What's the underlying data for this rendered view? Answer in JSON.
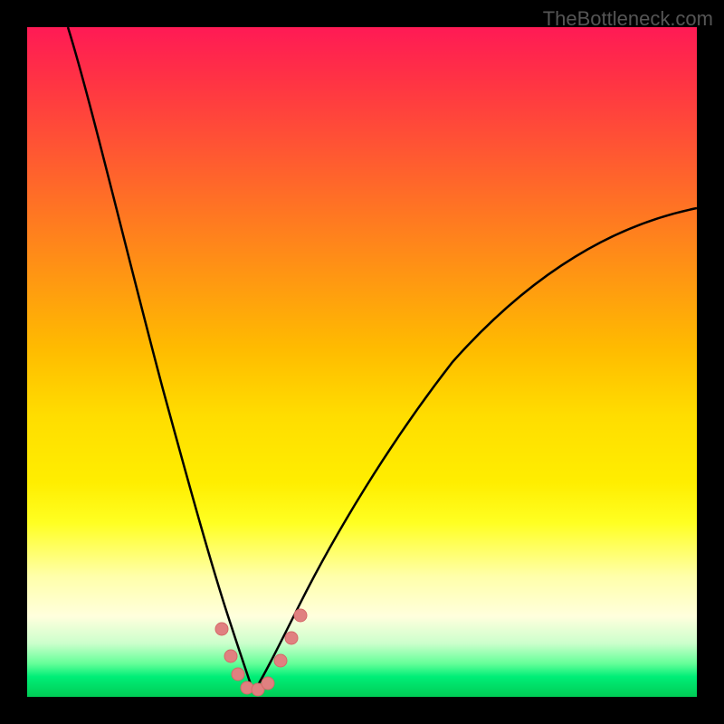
{
  "watermark": "TheBottleneck.com",
  "chart_data": {
    "type": "line",
    "title": "",
    "xlabel": "",
    "ylabel": "",
    "xlim": [
      0,
      100
    ],
    "ylim": [
      0,
      100
    ],
    "description": "Bottleneck V-curve over rainbow gradient background (red=high bottleneck at top, green=optimal at bottom). Two black curves descend from upper edges to meet near x≈33 at the bottom, with salmon dot markers near the minimum.",
    "background_gradient": {
      "stops": [
        {
          "pos": 0,
          "color": "#ff1a55"
        },
        {
          "pos": 0.5,
          "color": "#ffdd00"
        },
        {
          "pos": 0.9,
          "color": "#ffffdd"
        },
        {
          "pos": 1.0,
          "color": "#00cc55"
        }
      ]
    },
    "series": [
      {
        "name": "left-curve",
        "x": [
          5,
          8,
          12,
          16,
          20,
          24,
          27,
          30,
          32,
          33
        ],
        "y": [
          100,
          85,
          68,
          52,
          38,
          25,
          15,
          7,
          2,
          0
        ]
      },
      {
        "name": "right-curve",
        "x": [
          33,
          36,
          40,
          45,
          52,
          60,
          70,
          82,
          95,
          100
        ],
        "y": [
          0,
          3,
          9,
          18,
          30,
          42,
          54,
          64,
          71,
          73
        ]
      }
    ],
    "markers": {
      "name": "optimal-points",
      "color": "#e57373",
      "points": [
        {
          "x": 29,
          "y": 10
        },
        {
          "x": 30.5,
          "y": 5
        },
        {
          "x": 31.5,
          "y": 2
        },
        {
          "x": 33,
          "y": 0.5
        },
        {
          "x": 34.5,
          "y": 0.5
        },
        {
          "x": 36,
          "y": 1.5
        },
        {
          "x": 38,
          "y": 5
        },
        {
          "x": 39.5,
          "y": 8
        },
        {
          "x": 41,
          "y": 11
        }
      ]
    }
  }
}
